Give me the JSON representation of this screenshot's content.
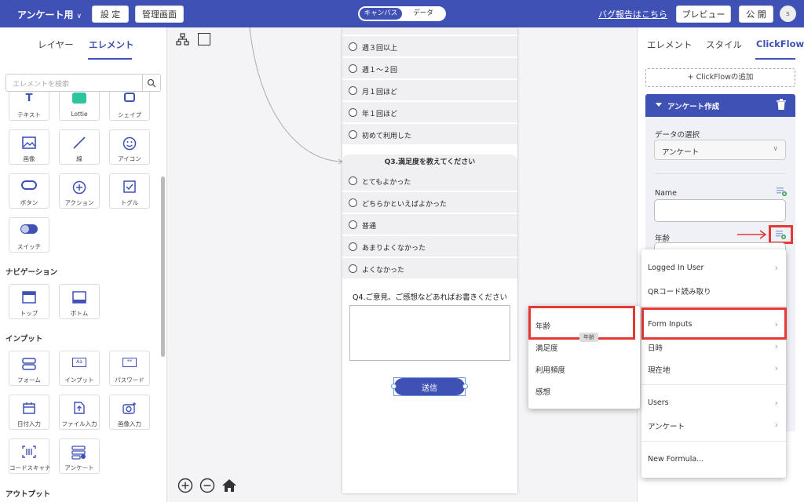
{
  "topbar": {
    "app_title": "アンケート用",
    "settings_label": "設 定",
    "admin_label": "管理画面",
    "mode_tabs": [
      "キャンバス",
      "データ"
    ],
    "bug_report": "バグ報告はこちら",
    "preview_label": "プレビュー",
    "publish_label": "公 開",
    "avatar_initial": "s"
  },
  "left": {
    "tabs": [
      "レイヤー",
      "エレメント"
    ],
    "search_placeholder": "エレメントを検索",
    "elements_row0": [
      "テキスト",
      "Lottie",
      "シェイプ"
    ],
    "elements_row1": [
      "画像",
      "線",
      "アイコン"
    ],
    "elements_row2": [
      "ボタン",
      "アクション",
      "トグル"
    ],
    "elements_row3": [
      "スイッチ"
    ],
    "section_nav": "ナビゲーション",
    "nav_items": [
      "トップ",
      "ボトム"
    ],
    "section_input": "インプット",
    "input_row0": [
      "フォーム",
      "インプット",
      "パスワード"
    ],
    "input_row1": [
      "日付入力",
      "ファイル入力",
      "画像入力"
    ],
    "input_row2": [
      "コードスキャナ",
      "アンケート"
    ],
    "section_output": "アウトプット"
  },
  "canvas": {
    "q2_options": [
      "週３回以上",
      "週１〜２回",
      "月１回ほど",
      "年１回ほど",
      "初めて利用した"
    ],
    "q3_title": "Q3.満足度を教えてください",
    "q3_options": [
      "とてもよかった",
      "どちらかといえばよかった",
      "普通",
      "あまりよくなかった",
      "よくなかった"
    ],
    "q4_title": "Q4.ご意見、ご感想などあればお書きください",
    "submit_label": "送信"
  },
  "right": {
    "tabs": [
      "エレメント",
      "スタイル",
      "ClickFlow"
    ],
    "add_clickflow": "+ ClickFlowの追加",
    "flow_title": "アンケート作成",
    "data_select_label": "データの選択",
    "data_select_value": "アンケート",
    "field_name": "Name",
    "field_age": "年齢"
  },
  "formula_menu": {
    "items": [
      "Logged In User",
      "QRコード読み取り",
      "Form Inputs",
      "日時",
      "現在地",
      "Users",
      "アンケート",
      "New Formula..."
    ]
  },
  "submenu": {
    "items": [
      "年齢",
      "満足度",
      "利用頻度",
      "感想"
    ],
    "tooltip": "年齢"
  },
  "colors": {
    "primary": "#3f51b5",
    "highlight": "#e53935"
  }
}
